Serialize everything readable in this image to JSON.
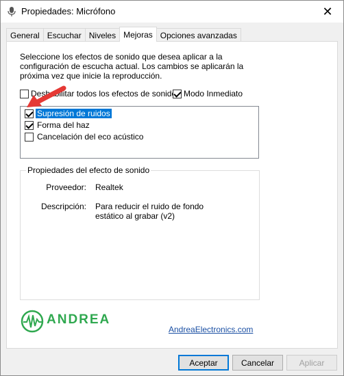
{
  "window": {
    "title": "Propiedades: Micrófono"
  },
  "tabs": [
    {
      "label": "General"
    },
    {
      "label": "Escuchar"
    },
    {
      "label": "Niveles"
    },
    {
      "label": "Mejoras"
    },
    {
      "label": "Opciones avanzadas"
    }
  ],
  "enhancements": {
    "description": "Seleccione los efectos de sonido que desea aplicar a la configuración de escucha actual. Los cambios se aplicarán la próxima vez que inicie la reproducción.",
    "disable_all": {
      "label": "Deshabilitar todos los efectos de sonido",
      "checked": false
    },
    "immediate_mode": {
      "label": "Modo Inmediato",
      "checked": true
    },
    "effects": [
      {
        "label": "Supresión de ruidos",
        "checked": true,
        "selected": true
      },
      {
        "label": "Forma del haz",
        "checked": true,
        "selected": false
      },
      {
        "label": "Cancelación del eco acústico",
        "checked": false,
        "selected": false
      }
    ],
    "properties": {
      "legend": "Propiedades del efecto de sonido",
      "provider_label": "Proveedor:",
      "provider_value": "Realtek",
      "description_label": "Descripción:",
      "description_value": "Para reducir el ruido de fondo estático al grabar (v2)"
    },
    "logo_text": "ANDREA",
    "link": "AndreaElectronics.com"
  },
  "buttons": {
    "accept": "Aceptar",
    "cancel": "Cancelar",
    "apply": "Aplicar"
  },
  "colors": {
    "selection": "#0078d7",
    "logo_green": "#2fa84f",
    "annotation_red": "#e53935"
  }
}
